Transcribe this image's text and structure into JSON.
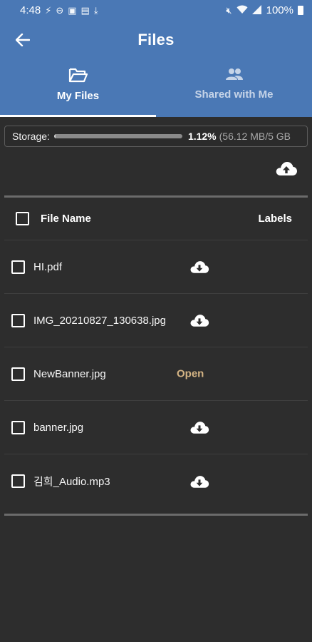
{
  "status": {
    "time": "4:48",
    "battery": "100%"
  },
  "header": {
    "title": "Files"
  },
  "tabs": [
    {
      "label": "My Files",
      "icon": "folder-open-icon",
      "active": true
    },
    {
      "label": "Shared with Me",
      "icon": "people-icon",
      "active": false
    }
  ],
  "storage": {
    "label": "Storage:",
    "percent_text": "1.12%",
    "detail": "(56.12 MB/5 GB",
    "percent_value": 1.12
  },
  "table": {
    "col_name": "File Name",
    "col_labels": "Labels"
  },
  "files": [
    {
      "name": "HI.pdf",
      "action": "download"
    },
    {
      "name": "IMG_20210827_130638.jpg",
      "action": "download"
    },
    {
      "name": "NewBanner.jpg",
      "action": "open",
      "action_label": "Open"
    },
    {
      "name": "banner.jpg",
      "action": "download"
    },
    {
      "name": "김희_Audio.mp3",
      "action": "download"
    }
  ],
  "colors": {
    "header": "#4a78b5",
    "background": "#2d2d2d",
    "open_link": "#d4b484"
  }
}
